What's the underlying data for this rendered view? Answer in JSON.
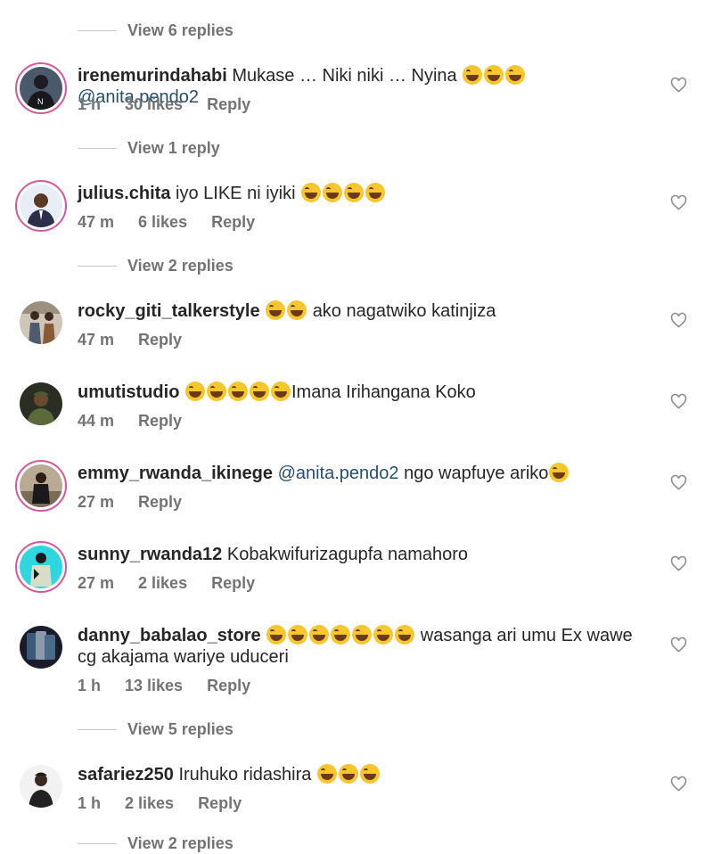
{
  "view_replies": [
    {
      "label": "View 6 replies"
    },
    {
      "label": "View 1 reply"
    },
    {
      "label": "View 2 replies"
    },
    {
      "label": "View 5 replies"
    },
    {
      "label": "View 2 replies"
    }
  ],
  "comments": [
    {
      "username": "irenemurindahabi",
      "text": "Mukase … Niki niki … Nyina",
      "mention": "@anita.pendo2",
      "time": "1 h",
      "likes": "30 likes",
      "reply": "Reply"
    },
    {
      "username": "julius.chita",
      "text": "iyo LIKE ni iyiki",
      "time": "47 m",
      "likes": "6 likes",
      "reply": "Reply"
    },
    {
      "username": "rocky_giti_talkerstyle",
      "text": "ako nagatwiko katinjiza",
      "time": "47 m",
      "reply": "Reply"
    },
    {
      "username": "umutistudio",
      "text": "Imana Irihangana Koko",
      "time": "44 m",
      "reply": "Reply"
    },
    {
      "username": "emmy_rwanda_ikinege",
      "mention": "@anita.pendo2",
      "text": "ngo wapfuye ariko",
      "time": "27 m",
      "reply": "Reply"
    },
    {
      "username": "sunny_rwanda12",
      "text": "Kobakwifurizagupfa namahoro",
      "time": "27 m",
      "likes": "2 likes",
      "reply": "Reply"
    },
    {
      "username": "danny_babalao_store",
      "text": "wasanga ari umu Ex wawe cg akajama wariye uduceri",
      "time": "1 h",
      "likes": "13 likes",
      "reply": "Reply"
    },
    {
      "username": "safariez250",
      "text": "Iruhuko ridashira",
      "time": "1 h",
      "likes": "2 likes",
      "reply": "Reply"
    }
  ],
  "icons": {
    "like": "heart-outline-icon",
    "emoji": "grinning-squinting-face-emoji"
  },
  "colors": {
    "mention": "#264e6f",
    "muted": "#737373",
    "story_ring": "#d8579a",
    "emoji": "#f7c52c"
  }
}
